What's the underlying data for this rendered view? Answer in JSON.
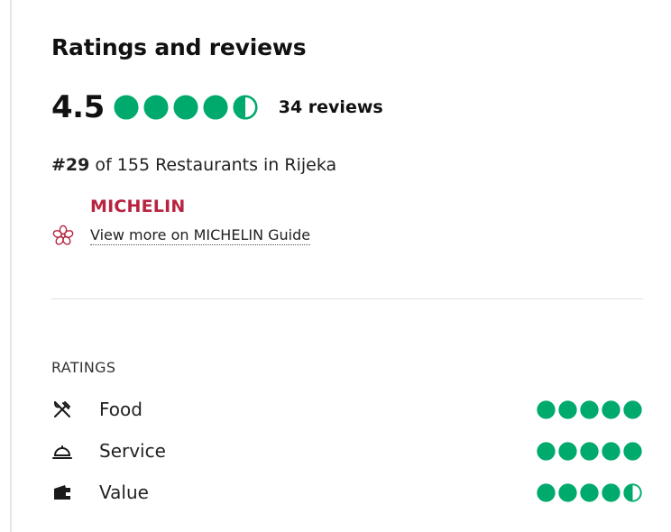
{
  "section": {
    "title": "Ratings and reviews"
  },
  "overall": {
    "score": "4.5",
    "bubble_rating": 4.5,
    "review_count": "34 reviews"
  },
  "ranking": {
    "rank": "#29",
    "text": " of 155 Restaurants in Rijeka"
  },
  "michelin": {
    "title": "MICHELIN",
    "link": "View more on MICHELIN Guide",
    "icon": "michelin-flower-icon"
  },
  "ratings": {
    "label": "RATINGS",
    "items": [
      {
        "name": "Food",
        "icon": "utensils-icon",
        "rating": 5
      },
      {
        "name": "Service",
        "icon": "service-bell-icon",
        "rating": 5
      },
      {
        "name": "Value",
        "icon": "wallet-icon",
        "rating": 4.5
      }
    ]
  },
  "colors": {
    "bubble": "#00aa6c",
    "michelin": "#b6243f",
    "divider": "#e0e0e0"
  }
}
